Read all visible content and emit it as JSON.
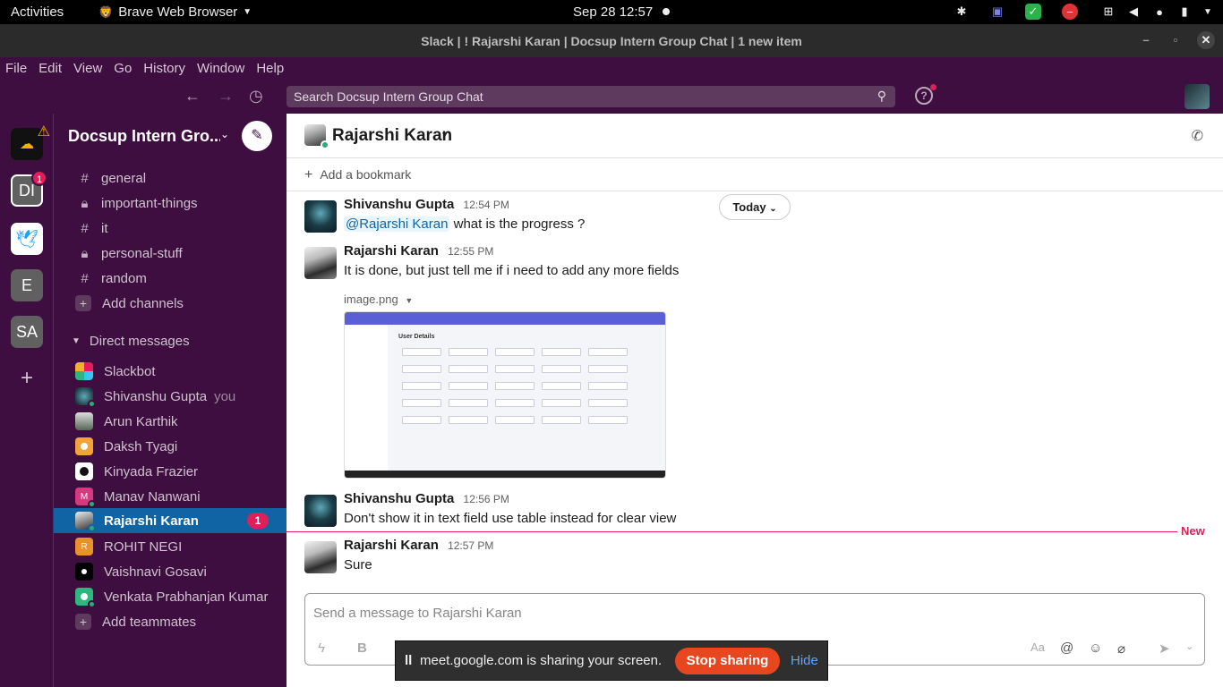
{
  "system": {
    "activities": "Activities",
    "app_name": "Brave Web Browser",
    "clock": "Sep 28  12:57"
  },
  "window": {
    "title": "Slack | ! Rajarshi Karan | Docsup Intern Group Chat | 1 new item"
  },
  "menu": [
    "File",
    "Edit",
    "View",
    "Go",
    "History",
    "Window",
    "Help"
  ],
  "search": {
    "placeholder": "Search Docsup Intern Group Chat"
  },
  "workspaces": [
    {
      "label": "",
      "icon": "cloud-warning-icon"
    },
    {
      "label": "DI",
      "badge": "1"
    },
    {
      "label": "",
      "icon": "bird-icon"
    },
    {
      "label": "E"
    },
    {
      "label": "SA"
    },
    {
      "label": "+"
    }
  ],
  "sidebar": {
    "workspace_name": "Docsup Intern Gro...",
    "channels": [
      {
        "icon": "#",
        "name": "general"
      },
      {
        "icon": "lock",
        "name": "important-things"
      },
      {
        "icon": "#",
        "name": "it"
      },
      {
        "icon": "lock",
        "name": "personal-stuff"
      },
      {
        "icon": "#",
        "name": "random"
      }
    ],
    "add_channels": "Add channels",
    "dm_header": "Direct messages",
    "dms": [
      {
        "name": "Slackbot",
        "color": "#f4b400"
      },
      {
        "name": "Shivanshu Gupta",
        "suffix": "you",
        "color": "#1b3d48"
      },
      {
        "name": "Arun Karthik",
        "color": "#6b7b6b"
      },
      {
        "name": "Daksh Tyagi",
        "color": "#f1a33c"
      },
      {
        "name": "Kinyada Frazier",
        "color": "#111111"
      },
      {
        "name": "Manav Nanwani",
        "letter": "M",
        "color": "#d63a7e"
      },
      {
        "name": "Rajarshi Karan",
        "badge": "1",
        "color": "#888888"
      },
      {
        "name": "ROHIT NEGI",
        "letter": "R",
        "color": "#e8912d"
      },
      {
        "name": "Vaishnavi Gosavi",
        "color": "#000000"
      },
      {
        "name": "Venkata Prabhanjan Kumar",
        "color": "#2eb67d"
      }
    ],
    "add_teammates": "Add teammates"
  },
  "channel": {
    "name": "Rajarshi Karan",
    "add_bookmark": "Add a bookmark",
    "today": "Today"
  },
  "messages": [
    {
      "author": "Shivanshu Gupta",
      "time": "12:54 PM",
      "mention": "@Rajarshi Karan",
      "text": " what is the progress ?"
    },
    {
      "author": "Rajarshi Karan",
      "time": "12:55 PM",
      "text": "It is done, but just tell me if i need to add any more fields",
      "attachment": "image.png"
    },
    {
      "author": "Shivanshu Gupta",
      "time": "12:56 PM",
      "text": "Don't show it in text field use table instead for clear view"
    },
    {
      "author": "Rajarshi Karan",
      "time": "12:57 PM",
      "text": "Sure"
    }
  ],
  "attachment_preview": {
    "title": "User Details"
  },
  "new_marker": "New",
  "composer": {
    "placeholder": "Send a message to Rajarshi Karan"
  },
  "share": {
    "message": "meet.google.com is sharing your screen.",
    "stop": "Stop sharing",
    "hide": "Hide"
  }
}
